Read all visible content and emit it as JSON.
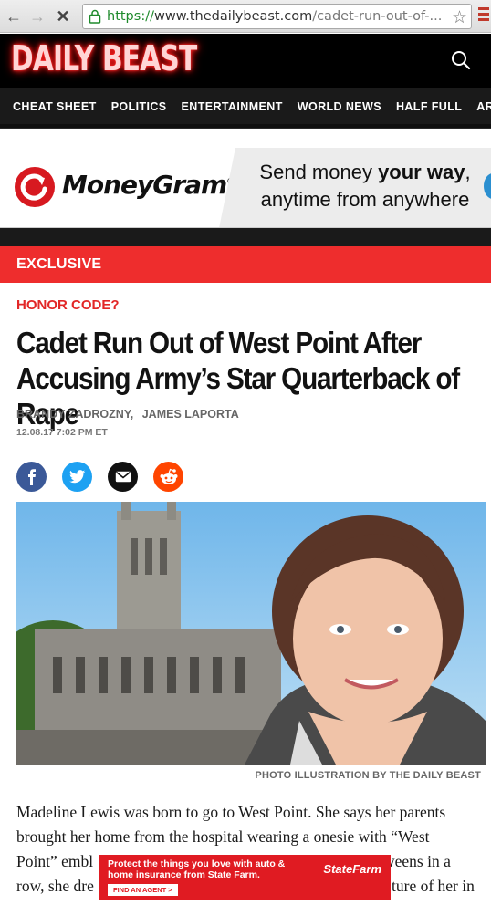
{
  "browser": {
    "url_scheme": "https://",
    "url_host": "www.thedailybeast.com",
    "url_path": "/cadet-run-out-of-..."
  },
  "site": {
    "logo": "DAILY BEAST",
    "nav": [
      "CHEAT SHEET",
      "POLITICS",
      "ENTERTAINMENT",
      "WORLD NEWS",
      "HALF FULL",
      "ARTS"
    ]
  },
  "ad_top": {
    "brand": "MoneyGram",
    "message_plain_1": "Send money ",
    "message_bold": "your way",
    "message_plain_2": ",",
    "message_line2": "anytime from anywhere"
  },
  "article": {
    "section_banner": "EXCLUSIVE",
    "kicker": "HONOR CODE?",
    "headline": "Cadet Run Out of West Point After Accusing Army’s Star Quarterback of Rape",
    "authors": [
      "BRANDY ZADROZNY,",
      "JAMES LAPORTA"
    ],
    "date": "12.08.17 7:02 PM ET",
    "image_caption": "PHOTO ILLUSTRATION BY THE DAILY BEAST",
    "body_lines": [
      "Madeline Lewis was born to go to West Point. She says her parents",
      "brought her home from the hospital wearing a onesie with “West",
      "Point” embl",
      "row, she dre"
    ],
    "body_tail_3": "weens in a",
    "body_tail_4": "ture of her in"
  },
  "ad_bottom": {
    "text": "Protect the things you love with auto & home insurance from State Farm.",
    "cta": "FIND AN AGENT  >",
    "brand": "StateFarm"
  },
  "colors": {
    "brand_red": "#ee2d2d",
    "kicker_red": "#e22727",
    "header_black": "#000000"
  }
}
